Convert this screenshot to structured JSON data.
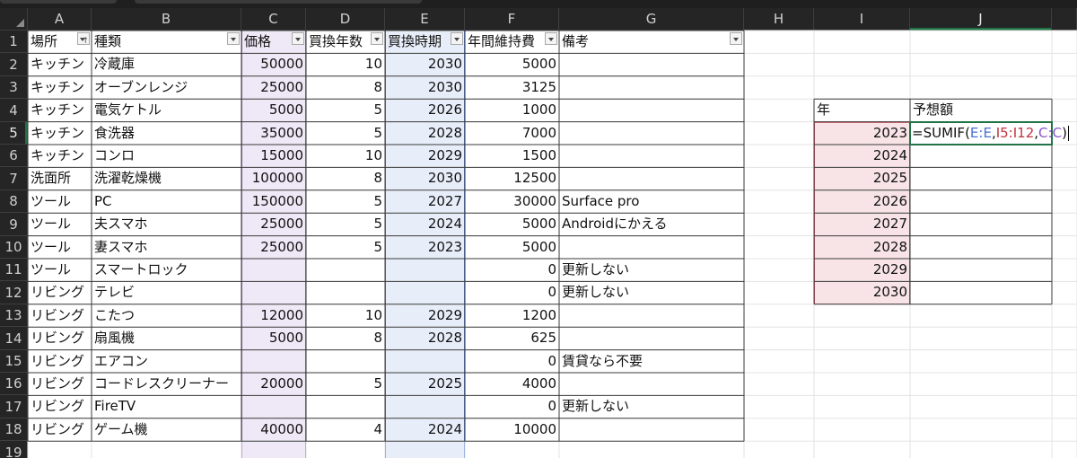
{
  "columns": [
    "A",
    "B",
    "C",
    "D",
    "E",
    "F",
    "G",
    "H",
    "I",
    "J"
  ],
  "rows": [
    "1",
    "2",
    "3",
    "4",
    "5",
    "6",
    "7",
    "8",
    "9",
    "10",
    "11",
    "12",
    "13",
    "14",
    "15",
    "16",
    "17",
    "18",
    "19"
  ],
  "table": {
    "headers": [
      "場所",
      "種類",
      "価格",
      "買換年数",
      "買換時期",
      "年間維持費",
      "備考"
    ],
    "rows": [
      [
        "キッチン",
        "冷蔵庫",
        "50000",
        "10",
        "2030",
        "5000",
        ""
      ],
      [
        "キッチン",
        "オーブンレンジ",
        "25000",
        "8",
        "2030",
        "3125",
        ""
      ],
      [
        "キッチン",
        "電気ケトル",
        "5000",
        "5",
        "2026",
        "1000",
        ""
      ],
      [
        "キッチン",
        "食洗器",
        "35000",
        "5",
        "2028",
        "7000",
        ""
      ],
      [
        "キッチン",
        "コンロ",
        "15000",
        "10",
        "2029",
        "1500",
        ""
      ],
      [
        "洗面所",
        "洗濯乾燥機",
        "100000",
        "8",
        "2030",
        "12500",
        ""
      ],
      [
        "ツール",
        "PC",
        "150000",
        "5",
        "2027",
        "30000",
        "Surface pro"
      ],
      [
        "ツール",
        "夫スマホ",
        "25000",
        "5",
        "2024",
        "5000",
        "Androidにかえる"
      ],
      [
        "ツール",
        "妻スマホ",
        "25000",
        "5",
        "2023",
        "5000",
        ""
      ],
      [
        "ツール",
        "スマートロック",
        "",
        "",
        "",
        "0",
        "更新しない"
      ],
      [
        "リビング",
        "テレビ",
        "",
        "",
        "",
        "0",
        "更新しない"
      ],
      [
        "リビング",
        "こたつ",
        "12000",
        "10",
        "2029",
        "1200",
        ""
      ],
      [
        "リビング",
        "扇風機",
        "5000",
        "8",
        "2028",
        "625",
        ""
      ],
      [
        "リビング",
        "エアコン",
        "",
        "",
        "",
        "0",
        "賃貸なら不要"
      ],
      [
        "リビング",
        "コードレスクリーナー",
        "20000",
        "5",
        "2025",
        "4000",
        ""
      ],
      [
        "リビング",
        "FireTV",
        "",
        "",
        "",
        "0",
        "更新しない"
      ],
      [
        "リビング",
        "ゲーム機",
        "40000",
        "4",
        "2024",
        "10000",
        ""
      ]
    ]
  },
  "forecast": {
    "header_year": "年",
    "header_amount": "予想額",
    "years": [
      "2023",
      "2024",
      "2025",
      "2026",
      "2027",
      "2028",
      "2029",
      "2030"
    ]
  },
  "formula": {
    "prefix": "=SUMIF(",
    "ref1": "E:E",
    "sep1": ",",
    "ref2": "I5:I12",
    "sep2": ",",
    "ref3": "C:C",
    "suffix": ")"
  },
  "colors": {
    "header_bg": "#252525",
    "price_col_bg": "#efe9f7",
    "price_col_border": "#9f6fd0",
    "period_col_bg": "#e8eef9",
    "period_col_border": "#5b84d8",
    "year_col_bg": "#f8e4e6",
    "year_col_border": "#d45a66",
    "selection_green": "#217346"
  }
}
